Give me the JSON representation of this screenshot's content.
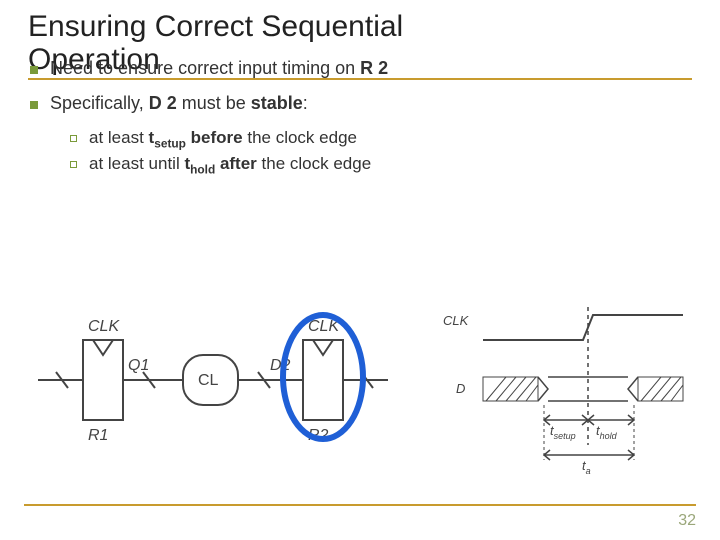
{
  "title_line1": "Ensuring Correct Sequential",
  "title_line2": "Operation",
  "bullet1_pre": "Need to ensure correct input timing on ",
  "bullet1_bold": "R 2",
  "bullet2_pre": "Specifically, ",
  "bullet2_bold1": "D 2",
  "bullet2_mid": " must be ",
  "bullet2_bold2": "stable",
  "bullet2_post": ":",
  "sub1_pre": "at least ",
  "sub1_t": "t",
  "sub1_sub": "setup",
  "sub1_bold": " before",
  "sub1_post": " the clock edge",
  "sub2_pre": "at least until ",
  "sub2_t": "t",
  "sub2_sub": "hold",
  "sub2_bold": " after",
  "sub2_post": " the clock edge",
  "page_number": "32",
  "diagram": {
    "labels": {
      "clk_left1": "CLK",
      "clk_left2": "CLK",
      "q1": "Q1",
      "cl": "CL",
      "d2": "D2",
      "r1": "R1",
      "r2": "R2",
      "clk_right": "CLK",
      "d_right": "D",
      "tsetup": "t",
      "tsetup_sub": "setup",
      "thold": "t",
      "thold_sub": "hold",
      "ta": "t",
      "ta_sub": "a"
    }
  }
}
